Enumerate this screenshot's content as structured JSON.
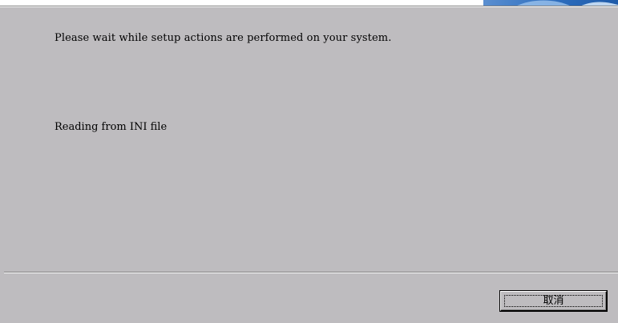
{
  "wizard": {
    "message": "Please wait while setup actions are performed on your system.",
    "status_text": "Reading from INI file"
  },
  "buttons": {
    "cancel_label": "取消"
  },
  "colors": {
    "background": "#bebcbf",
    "banner_blue": "#3a7bc8"
  }
}
